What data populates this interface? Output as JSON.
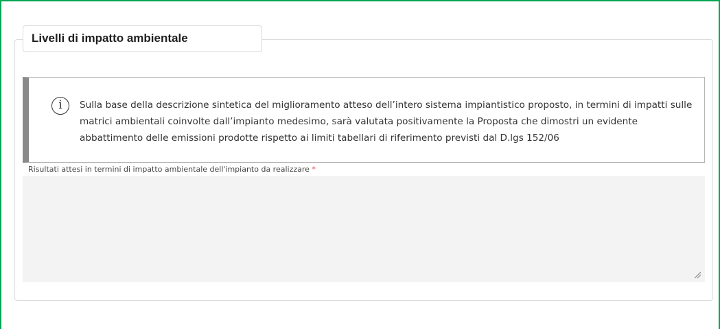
{
  "section": {
    "title": "Livelli di impatto ambientale"
  },
  "info_box": {
    "icon": "info-circle-icon",
    "text": "Sulla base della descrizione sintetica del miglioramento atteso dell’intero sistema impiantistico proposto, in termini di impatti sulle matrici ambientali coinvolte dall’impianto medesimo, sarà valutata positivamente la Proposta che dimostri un evidente abbattimento delle emissioni prodotte rispetto ai limiti tabellari di riferimento previsti dal D.lgs 152/06"
  },
  "field": {
    "label": "Risultati attesi in termini di impatto ambientale dell'impianto da realizzare",
    "required_marker": "*",
    "value": "",
    "resize_icon": "resize-handle-icon"
  },
  "colors": {
    "frame_accent": "#00a651",
    "callout_bar": "#8a8a8a",
    "required": "#d9534f",
    "textarea_bg": "#f3f3f3"
  }
}
